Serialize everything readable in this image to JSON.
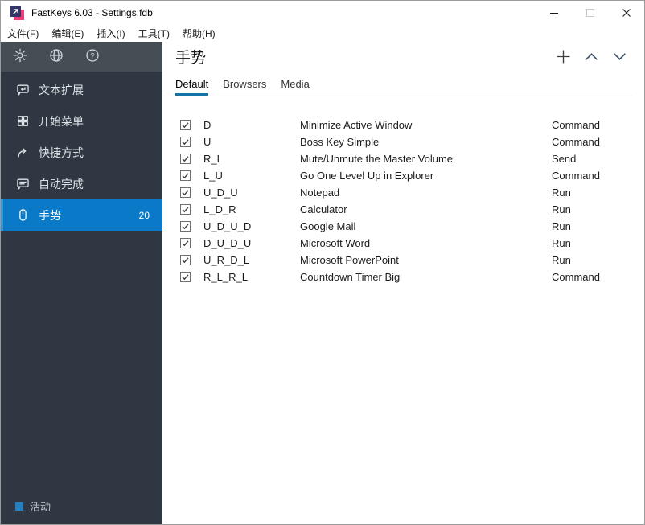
{
  "window": {
    "title": "FastKeys 6.03 - Settings.fdb",
    "controls": [
      {
        "name": "minimize",
        "icon": "minimize-icon"
      },
      {
        "name": "maximize",
        "icon": "maximize-icon"
      },
      {
        "name": "close",
        "icon": "close-icon"
      }
    ]
  },
  "menubar": {
    "items": [
      {
        "name": "file",
        "label": "文件(F)"
      },
      {
        "name": "edit",
        "label": "编辑(E)"
      },
      {
        "name": "insert",
        "label": "插入(I)"
      },
      {
        "name": "tools",
        "label": "工具(T)"
      },
      {
        "name": "help",
        "label": "帮助(H)"
      }
    ]
  },
  "sidebar": {
    "top_icons": [
      {
        "name": "settings",
        "icon": "gear"
      },
      {
        "name": "language",
        "icon": "globe"
      },
      {
        "name": "help",
        "icon": "help"
      }
    ],
    "items": [
      {
        "name": "text-expansion",
        "icon": "speech-bubble-arrow",
        "label": "文本扩展",
        "selected": false
      },
      {
        "name": "start-menu",
        "icon": "grid",
        "label": "开始菜单",
        "selected": false
      },
      {
        "name": "shortcuts",
        "icon": "share-arrow",
        "label": "快捷方式",
        "selected": false
      },
      {
        "name": "autocomplete",
        "icon": "speech-bubble-lines",
        "label": "自动完成",
        "selected": false
      },
      {
        "name": "gestures",
        "icon": "mouse",
        "label": "手势",
        "selected": true,
        "badge": "20"
      }
    ],
    "footer": {
      "label": "活动"
    }
  },
  "main": {
    "title": "手势",
    "actions": [
      {
        "name": "add",
        "icon": "plus"
      },
      {
        "name": "move-up",
        "icon": "chevron-up"
      },
      {
        "name": "move-down",
        "icon": "chevron-down"
      }
    ],
    "tabs": [
      {
        "name": "default",
        "label": "Default",
        "active": true
      },
      {
        "name": "browsers",
        "label": "Browsers",
        "active": false
      },
      {
        "name": "media",
        "label": "Media",
        "active": false
      }
    ],
    "rows": [
      {
        "checked": true,
        "gesture": "D",
        "action": "Minimize Active Window",
        "type": "Command"
      },
      {
        "checked": true,
        "gesture": "U",
        "action": "Boss Key Simple",
        "type": "Command"
      },
      {
        "checked": true,
        "gesture": "R_L",
        "action": "Mute/Unmute the Master Volume",
        "type": "Send"
      },
      {
        "checked": true,
        "gesture": "L_U",
        "action": "Go One Level Up in Explorer",
        "type": "Command"
      },
      {
        "checked": true,
        "gesture": "U_D_U",
        "action": "Notepad",
        "type": "Run"
      },
      {
        "checked": true,
        "gesture": "L_D_R",
        "action": "Calculator",
        "type": "Run"
      },
      {
        "checked": true,
        "gesture": "U_D_U_D",
        "action": "Google Mail",
        "type": "Run"
      },
      {
        "checked": true,
        "gesture": "D_U_D_U",
        "action": "Microsoft Word",
        "type": "Run"
      },
      {
        "checked": true,
        "gesture": "U_R_D_L",
        "action": "Microsoft PowerPoint",
        "type": "Run"
      },
      {
        "checked": true,
        "gesture": "R_L_R_L",
        "action": "Countdown Timer Big",
        "type": "Command"
      }
    ]
  },
  "colors": {
    "accent": "#0a7ac8",
    "accent_stripe": "#3a97d3",
    "tab_underline": "#1273a8",
    "sidebar_bg": "#2f3842",
    "sidebar_top_bg": "#454d55",
    "active_square": "#2480c0",
    "app_icon_pink": "#ed3f7c",
    "app_icon_navy": "#35356b"
  }
}
